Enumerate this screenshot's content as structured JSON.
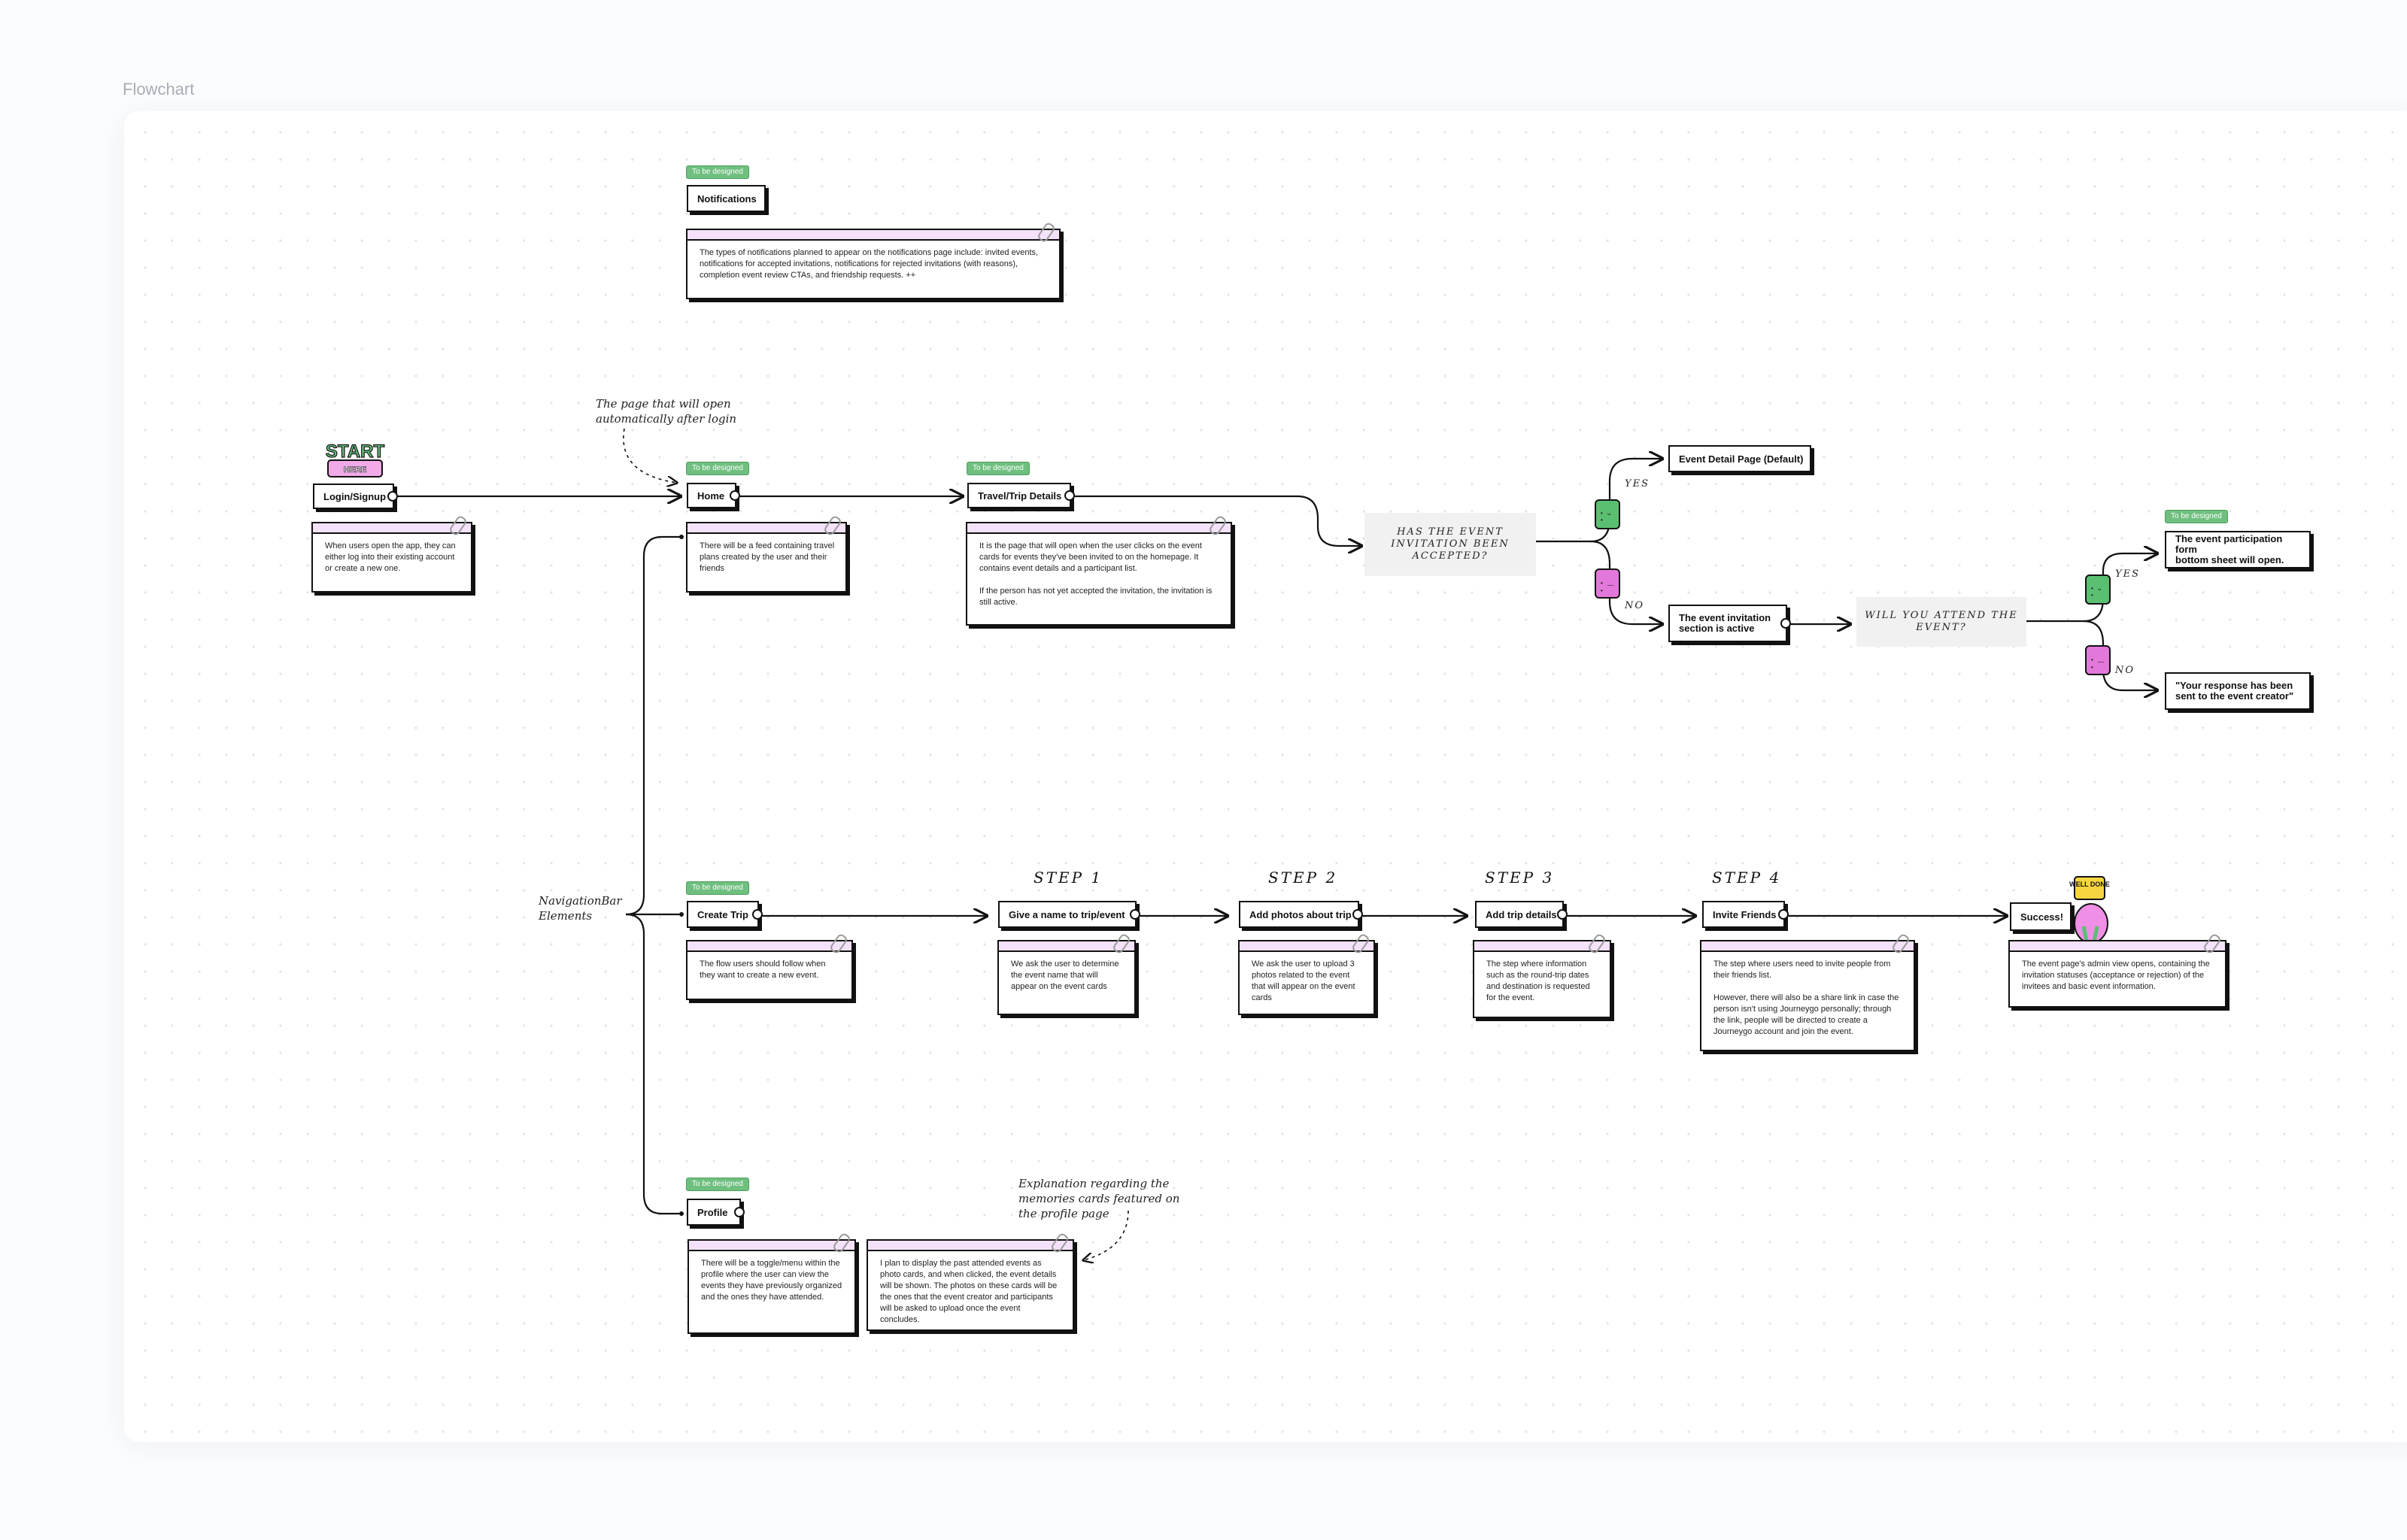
{
  "frame": {
    "title": "Flowchart"
  },
  "labels": {
    "badge": "To be designed"
  },
  "nodes": {
    "login": "Login/Signup",
    "home": "Home",
    "travel": "Travel/Trip Details",
    "notifications": "Notifications",
    "event_detail": "Event Detail Page (Default)",
    "invitation_active": "The event invitation\nsection is active",
    "participation_form": "The event participation form\nbottom sheet will open.",
    "response_sent": "\"Your response has been\nsent to the event creator\"",
    "create_trip": "Create Trip",
    "name_trip": "Give a  name to trip/event",
    "add_photos": "Add photos about trip",
    "add_details": "Add trip details",
    "invite": "Invite Friends",
    "success": "Success!",
    "profile": "Profile"
  },
  "cards": {
    "notifications": "The types of notifications planned to appear on the notifications page include: invited events, notifications for accepted invitations, notifications for rejected invitations (with reasons), completion event review CTAs, and friendship requests. ++",
    "login": "When users open the app, they can either log into their existing account or create a new one.",
    "home": "There will be a feed containing travel plans created by the user and their friends",
    "travel": "It is the page that will open when the user clicks on the event cards for events they've been invited to on the homepage. It contains event details and a participant list.\n\nIf the person has not yet accepted the invitation, the invitation is still active.",
    "create_trip": "The flow users should follow when they want to create a new event.",
    "name_trip": "We ask the user to determine the event name that will appear on the event cards",
    "add_photos": "We ask the user to upload 3 photos related to the event that will appear on the event cards",
    "add_details": "The step where information such as the round-trip dates and destination is requested for the event.",
    "invite": "The step where users need to invite people from their friends list.\n\nHowever, there will also be a share link in case the person isn't using Journeygo personally; through the link, people will be directed to create a Journeygo account and join the event.",
    "success": "The event page's admin view opens, containing the invitation statuses (acceptance or rejection) of the invitees and basic event information.",
    "profile": "There will be a toggle/menu within the profile where the user can view the events they have previously organized and the ones they have attended.",
    "memories": "I plan to display the past attended events as photo cards, and when clicked, the event details will be shown. The photos on these cards will be the ones that the event creator and participants will be asked to upload once the event concludes."
  },
  "decisions": {
    "accepted": "HAS THE EVENT\nINVITATION BEEN\nACCEPTED?",
    "attend": "WILL YOU ATTEND THE\nEVENT?"
  },
  "answers": {
    "yes": "YES",
    "no": "NO"
  },
  "steps": {
    "s1": "STEP 1",
    "s2": "STEP 2",
    "s3": "STEP 3",
    "s4": "STEP 4"
  },
  "annotations": {
    "home_note": "The page that will open\nautomatically after login",
    "navbar": "NavigationBar\nElements",
    "memories_note": "Explanation regarding the\nmemories cards featured on\nthe profile page"
  },
  "stickers": {
    "start": "START",
    "here": "HERE",
    "well_done": "WELL DONE"
  },
  "colors": {
    "badge_green": "#6fbf7f",
    "yes_green": "#5bbf72",
    "no_pink": "#e278d9",
    "card_strip": "#f3e2f9",
    "decision_bg": "#f1f1f1"
  }
}
